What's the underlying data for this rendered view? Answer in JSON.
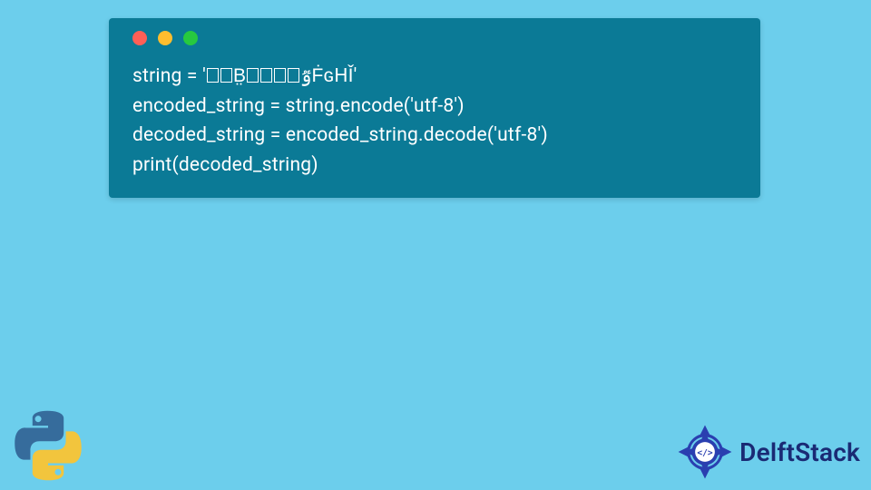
{
  "code": {
    "line1_prefix": "string = '",
    "line1_mid1": "B̤",
    "line1_mid2": "ٷḞɢHǏ",
    "line1_suffix": "'",
    "line2": "encoded_string = string.encode('utf-8')",
    "line3": "decoded_string = encoded_string.decode('utf-8')",
    "line4": "print(decoded_string)"
  },
  "brand": {
    "name": "DelftStack"
  },
  "icons": {
    "python": "python-logo",
    "delft_badge": "delftstack-badge"
  }
}
